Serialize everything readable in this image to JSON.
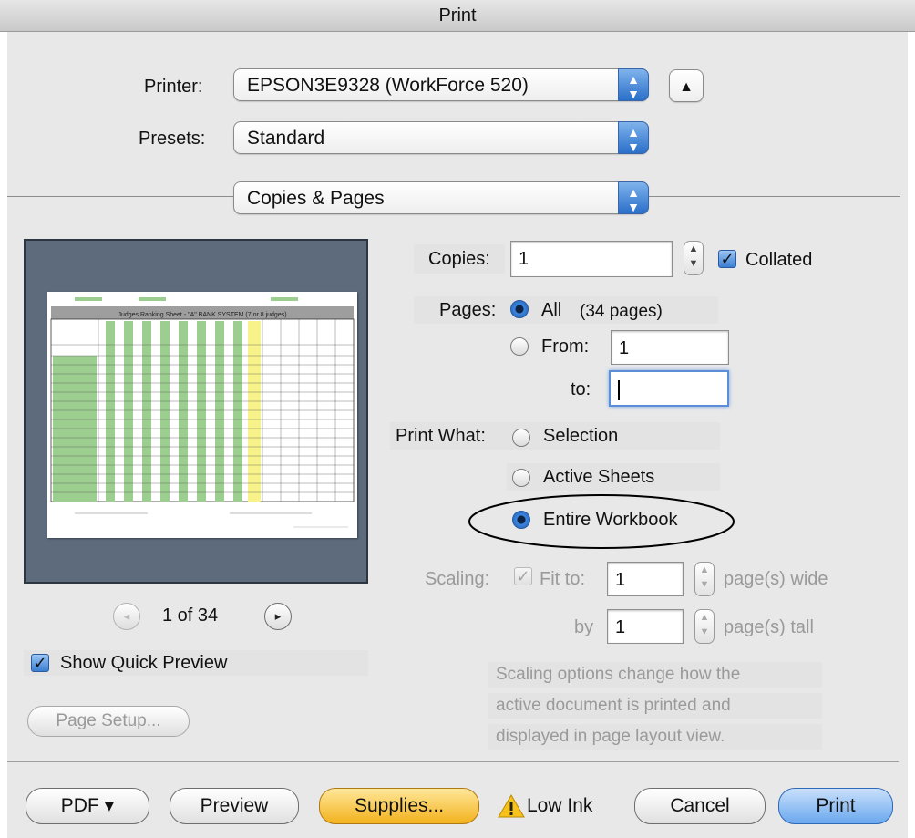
{
  "window": {
    "title": "Print"
  },
  "printer": {
    "label": "Printer:",
    "value": "EPSON3E9328 (WorkForce 520)"
  },
  "presets": {
    "label": "Presets:",
    "value": "Standard"
  },
  "section": {
    "value": "Copies & Pages"
  },
  "copies": {
    "label": "Copies:",
    "value": "1",
    "collated_label": "Collated",
    "collated": true
  },
  "pages": {
    "label": "Pages:",
    "all_label": "All",
    "all_count": "(34 pages)",
    "from_label": "From:",
    "from_value": "1",
    "to_label": "to:",
    "to_value": ""
  },
  "print_what": {
    "label": "Print What:",
    "options": [
      "Selection",
      "Active Sheets",
      "Entire Workbook"
    ],
    "selected": "Entire Workbook"
  },
  "scaling": {
    "label": "Scaling:",
    "fit_label": "Fit to:",
    "wide_value": "1",
    "wide_label": "page(s) wide",
    "by_label": "by",
    "tall_value": "1",
    "tall_label": "page(s) tall",
    "hint_lines": [
      "Scaling options change how the",
      "active document is printed and",
      "displayed in page layout view."
    ]
  },
  "preview": {
    "page_indicator": "1 of 34",
    "show_quick_preview_label": "Show Quick Preview",
    "show_quick_preview": true,
    "sheet_title": "Judges Ranking Sheet - \"A\" BANK SYSTEM (7 or 8 judges)"
  },
  "page_setup": {
    "label": "Page Setup..."
  },
  "footer": {
    "pdf_label": "PDF ▾",
    "preview_label": "Preview",
    "supplies_label": "Supplies...",
    "low_ink_label": "Low Ink",
    "cancel_label": "Cancel",
    "print_label": "Print"
  },
  "colors": {
    "accent": "#3a7fd2",
    "supplies": "#f2b21d",
    "sheet_green": "#9ccf8f",
    "sheet_yellow": "#f7f38a"
  }
}
